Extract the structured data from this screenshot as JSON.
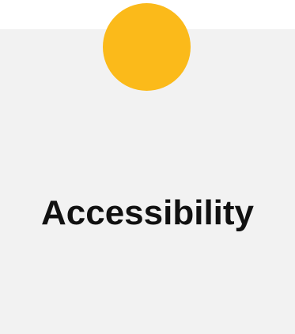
{
  "card": {
    "title": "Accessibility",
    "accent_color": "#fbba1a",
    "background_color": "#f2f2f2"
  }
}
